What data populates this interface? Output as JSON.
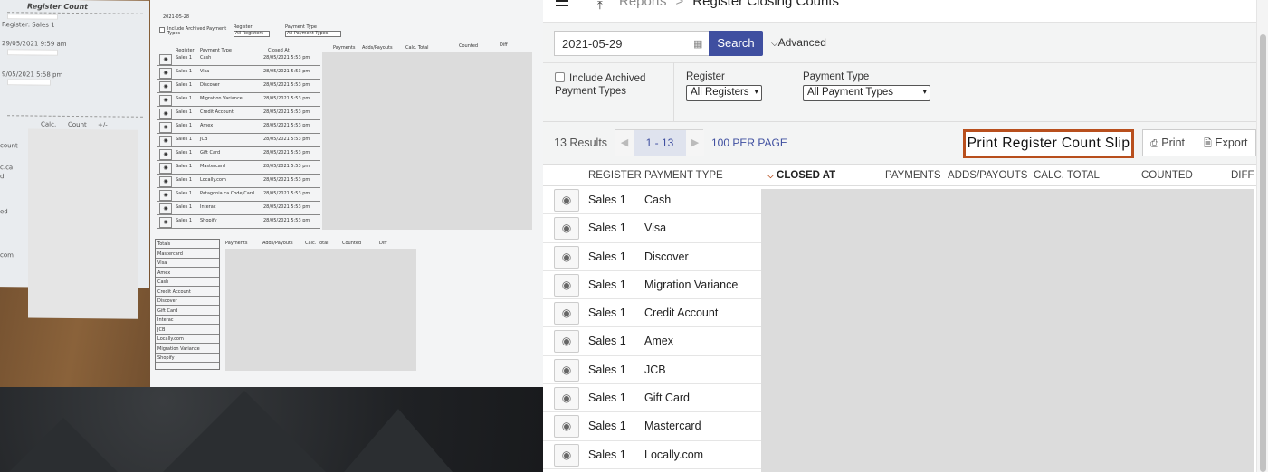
{
  "photo": {
    "receipt": {
      "title": "Register Count",
      "lines": [
        "Register: Sales 1",
        "29/05/2021 9:59 am",
        "9/05/2021 5:58 pm",
        "Calc.",
        "Count",
        "+/-",
        "count",
        "c.ca",
        "d",
        "ed",
        "com"
      ]
    },
    "sheet": {
      "date": "2021-05-28",
      "include_archived": "Include Archived Payment Types",
      "register_label": "Register",
      "register_value": "All Registers",
      "payment_type_label": "Payment Type",
      "payment_type_value": "All Payment Types",
      "col_register": "Register",
      "col_payment_type": "Payment Type",
      "col_closed_at": "Closed At",
      "col_payments": "Payments",
      "col_adds_payouts": "Adds/Payouts",
      "col_calc_total": "Calc. Total",
      "col_counted": "Counted",
      "col_diff": "Diff",
      "rows": [
        {
          "reg": "Sales 1",
          "ptype": "Cash",
          "closed": "28/05/2021 5:53 pm"
        },
        {
          "reg": "Sales 1",
          "ptype": "Visa",
          "closed": "28/05/2021 5:53 pm"
        },
        {
          "reg": "Sales 1",
          "ptype": "Discover",
          "closed": "28/05/2021 5:53 pm"
        },
        {
          "reg": "Sales 1",
          "ptype": "Migration Variance",
          "closed": "28/05/2021 5:53 pm"
        },
        {
          "reg": "Sales 1",
          "ptype": "Credit Account",
          "closed": "28/05/2021 5:53 pm"
        },
        {
          "reg": "Sales 1",
          "ptype": "Amex",
          "closed": "28/05/2021 5:53 pm"
        },
        {
          "reg": "Sales 1",
          "ptype": "JCB",
          "closed": "28/05/2021 5:53 pm"
        },
        {
          "reg": "Sales 1",
          "ptype": "Gift Card",
          "closed": "28/05/2021 5:53 pm"
        },
        {
          "reg": "Sales 1",
          "ptype": "Mastercard",
          "closed": "28/05/2021 5:53 pm"
        },
        {
          "reg": "Sales 1",
          "ptype": "Locally.com",
          "closed": "28/05/2021 5:53 pm"
        },
        {
          "reg": "Sales 1",
          "ptype": "Patagonia.ca Code/Card",
          "closed": "28/05/2021 5:53 pm"
        },
        {
          "reg": "Sales 1",
          "ptype": "Interac",
          "closed": "28/05/2021 5:53 pm"
        },
        {
          "reg": "Sales 1",
          "ptype": "Shopify",
          "closed": "28/05/2021 5:53 pm"
        }
      ],
      "totals": [
        "Totals",
        "Mastercard",
        "Visa",
        "Amex",
        "Cash",
        "Credit Account",
        "Discover",
        "Gift Card",
        "Interac",
        "JCB",
        "Locally.com",
        "Migration Variance",
        "Shopify"
      ],
      "totals_cols": [
        "Payments",
        "Adds/Payouts",
        "Calc. Total",
        "Counted",
        "Diff"
      ]
    }
  },
  "app": {
    "breadcrumb": {
      "parent": "Reports",
      "separator": ">",
      "current": "Register Closing Counts"
    },
    "filters": {
      "date_value": "2021-05-29",
      "search_label": "Search",
      "advanced_label": "Advanced",
      "archived_label": "Include Archived Payment Types",
      "register_label": "Register",
      "register_value": "All Registers",
      "payment_type_label": "Payment Type",
      "payment_type_value": "All Payment Types"
    },
    "toolbar": {
      "results": "13 Results",
      "page_range": "1 - 13",
      "per_page": "100 PER PAGE",
      "print_slip": "Print Register Count Slip",
      "print": "Print",
      "export": "Export"
    },
    "columns": {
      "register": "REGISTER",
      "payment_type": "PAYMENT TYPE",
      "closed_at": "CLOSED AT",
      "payments": "PAYMENTS",
      "adds_payouts": "ADDS/PAYOUTS",
      "calc_total": "CALC. TOTAL",
      "counted": "COUNTED",
      "diff": "DIFF"
    },
    "rows": [
      {
        "register": "Sales 1",
        "payment_type": "Cash"
      },
      {
        "register": "Sales 1",
        "payment_type": "Visa"
      },
      {
        "register": "Sales 1",
        "payment_type": "Discover"
      },
      {
        "register": "Sales 1",
        "payment_type": "Migration Variance"
      },
      {
        "register": "Sales 1",
        "payment_type": "Credit Account"
      },
      {
        "register": "Sales 1",
        "payment_type": "Amex"
      },
      {
        "register": "Sales 1",
        "payment_type": "JCB"
      },
      {
        "register": "Sales 1",
        "payment_type": "Gift Card"
      },
      {
        "register": "Sales 1",
        "payment_type": "Mastercard"
      },
      {
        "register": "Sales 1",
        "payment_type": "Locally.com"
      }
    ],
    "colors": {
      "accent": "#3f4fa0",
      "highlight_border": "#b84f1d",
      "redaction": "#dcdcdc"
    }
  }
}
